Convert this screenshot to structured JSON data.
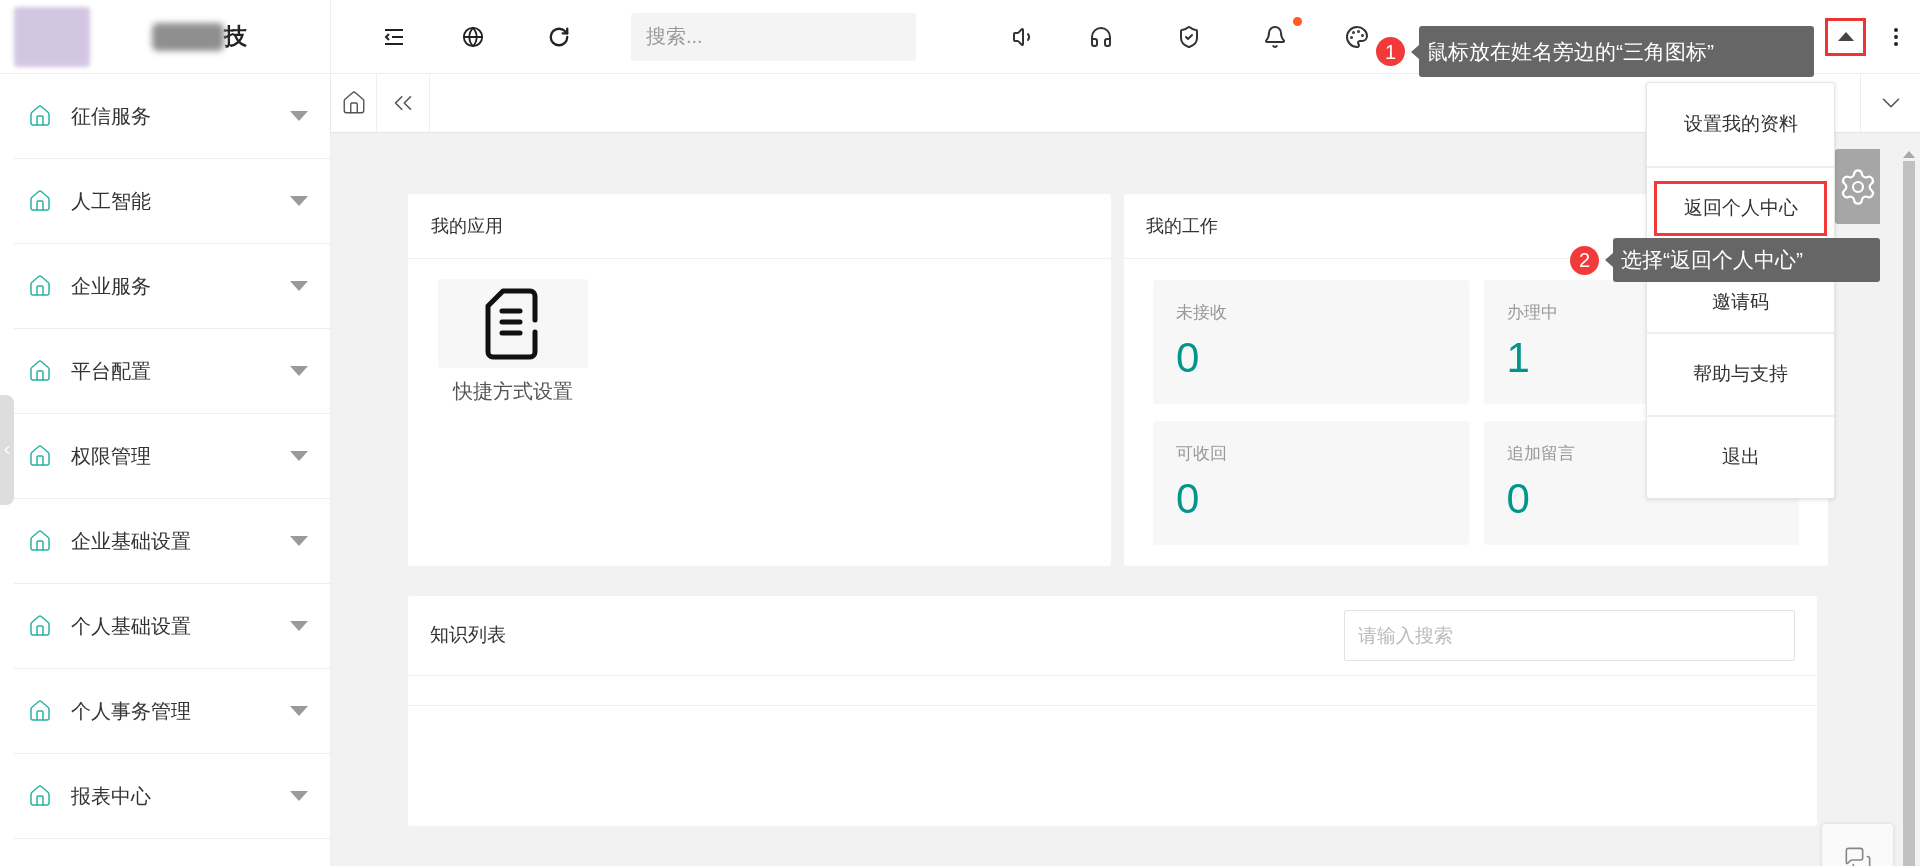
{
  "header": {
    "brand": "技",
    "search": {
      "placeholder": "搜索..."
    },
    "bell": {
      "unread": true
    },
    "menu_toggle": {
      "highlighted": true
    }
  },
  "sidebar": {
    "items": [
      {
        "label": "征信服务",
        "expanded": false
      },
      {
        "label": "人工智能",
        "expanded": false
      },
      {
        "label": "企业服务",
        "expanded": false
      },
      {
        "label": "平台配置",
        "expanded": false
      },
      {
        "label": "权限管理",
        "expanded": false
      },
      {
        "label": "企业基础设置",
        "expanded": false
      },
      {
        "label": "个人基础设置",
        "expanded": false
      },
      {
        "label": "个人事务管理",
        "expanded": false
      },
      {
        "label": "报表中心",
        "expanded": false
      }
    ]
  },
  "apps_card": {
    "title": "我的应用",
    "apps": [
      {
        "label": "快捷方式设置"
      }
    ]
  },
  "work_card": {
    "title": "我的工作",
    "stats": [
      {
        "label": "未接收",
        "value": "0"
      },
      {
        "label": "办理中",
        "value": "1"
      },
      {
        "label": "可收回",
        "value": "0"
      },
      {
        "label": "追加留言",
        "value": "0"
      }
    ]
  },
  "knowledge_card": {
    "title": "知识列表",
    "search": {
      "placeholder": "请输入搜索"
    }
  },
  "user_menu": {
    "items": [
      {
        "label": "设置我的资料",
        "highlighted": false
      },
      {
        "label": "返回个人中心",
        "highlighted": true
      },
      {
        "label": "邀请码",
        "highlighted": false
      },
      {
        "label": "帮助与支持",
        "highlighted": false
      },
      {
        "label": "退出",
        "highlighted": false
      }
    ]
  },
  "annotations": [
    {
      "number": "1",
      "text": "鼠标放在姓名旁边的“三角图标”"
    },
    {
      "number": "2",
      "text": "选择“返回个人中心”"
    }
  ]
}
